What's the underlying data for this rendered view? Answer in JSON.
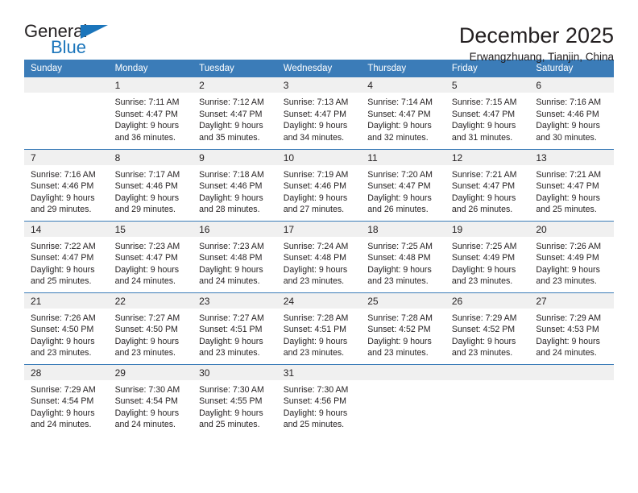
{
  "logo": {
    "word_primary": "General",
    "word_secondary": "Blue",
    "primary_color": "#231f20",
    "accent_color": "#1b75bb"
  },
  "header": {
    "title": "December 2025",
    "subtitle": "Erwangzhuang, Tianjin, China"
  },
  "theme": {
    "header_band": "#3b7cb8",
    "daynum_band": "#f0f0f0",
    "text": "#231f20"
  },
  "weekday_headers": [
    "Sunday",
    "Monday",
    "Tuesday",
    "Wednesday",
    "Thursday",
    "Friday",
    "Saturday"
  ],
  "weeks": [
    [
      {
        "day": "",
        "sunrise": "",
        "sunset": "",
        "daylight_line1": "",
        "daylight_line2": ""
      },
      {
        "day": "1",
        "sunrise": "Sunrise: 7:11 AM",
        "sunset": "Sunset: 4:47 PM",
        "daylight_line1": "Daylight: 9 hours",
        "daylight_line2": "and 36 minutes."
      },
      {
        "day": "2",
        "sunrise": "Sunrise: 7:12 AM",
        "sunset": "Sunset: 4:47 PM",
        "daylight_line1": "Daylight: 9 hours",
        "daylight_line2": "and 35 minutes."
      },
      {
        "day": "3",
        "sunrise": "Sunrise: 7:13 AM",
        "sunset": "Sunset: 4:47 PM",
        "daylight_line1": "Daylight: 9 hours",
        "daylight_line2": "and 34 minutes."
      },
      {
        "day": "4",
        "sunrise": "Sunrise: 7:14 AM",
        "sunset": "Sunset: 4:47 PM",
        "daylight_line1": "Daylight: 9 hours",
        "daylight_line2": "and 32 minutes."
      },
      {
        "day": "5",
        "sunrise": "Sunrise: 7:15 AM",
        "sunset": "Sunset: 4:47 PM",
        "daylight_line1": "Daylight: 9 hours",
        "daylight_line2": "and 31 minutes."
      },
      {
        "day": "6",
        "sunrise": "Sunrise: 7:16 AM",
        "sunset": "Sunset: 4:46 PM",
        "daylight_line1": "Daylight: 9 hours",
        "daylight_line2": "and 30 minutes."
      }
    ],
    [
      {
        "day": "7",
        "sunrise": "Sunrise: 7:16 AM",
        "sunset": "Sunset: 4:46 PM",
        "daylight_line1": "Daylight: 9 hours",
        "daylight_line2": "and 29 minutes."
      },
      {
        "day": "8",
        "sunrise": "Sunrise: 7:17 AM",
        "sunset": "Sunset: 4:46 PM",
        "daylight_line1": "Daylight: 9 hours",
        "daylight_line2": "and 29 minutes."
      },
      {
        "day": "9",
        "sunrise": "Sunrise: 7:18 AM",
        "sunset": "Sunset: 4:46 PM",
        "daylight_line1": "Daylight: 9 hours",
        "daylight_line2": "and 28 minutes."
      },
      {
        "day": "10",
        "sunrise": "Sunrise: 7:19 AM",
        "sunset": "Sunset: 4:46 PM",
        "daylight_line1": "Daylight: 9 hours",
        "daylight_line2": "and 27 minutes."
      },
      {
        "day": "11",
        "sunrise": "Sunrise: 7:20 AM",
        "sunset": "Sunset: 4:47 PM",
        "daylight_line1": "Daylight: 9 hours",
        "daylight_line2": "and 26 minutes."
      },
      {
        "day": "12",
        "sunrise": "Sunrise: 7:21 AM",
        "sunset": "Sunset: 4:47 PM",
        "daylight_line1": "Daylight: 9 hours",
        "daylight_line2": "and 26 minutes."
      },
      {
        "day": "13",
        "sunrise": "Sunrise: 7:21 AM",
        "sunset": "Sunset: 4:47 PM",
        "daylight_line1": "Daylight: 9 hours",
        "daylight_line2": "and 25 minutes."
      }
    ],
    [
      {
        "day": "14",
        "sunrise": "Sunrise: 7:22 AM",
        "sunset": "Sunset: 4:47 PM",
        "daylight_line1": "Daylight: 9 hours",
        "daylight_line2": "and 25 minutes."
      },
      {
        "day": "15",
        "sunrise": "Sunrise: 7:23 AM",
        "sunset": "Sunset: 4:47 PM",
        "daylight_line1": "Daylight: 9 hours",
        "daylight_line2": "and 24 minutes."
      },
      {
        "day": "16",
        "sunrise": "Sunrise: 7:23 AM",
        "sunset": "Sunset: 4:48 PM",
        "daylight_line1": "Daylight: 9 hours",
        "daylight_line2": "and 24 minutes."
      },
      {
        "day": "17",
        "sunrise": "Sunrise: 7:24 AM",
        "sunset": "Sunset: 4:48 PM",
        "daylight_line1": "Daylight: 9 hours",
        "daylight_line2": "and 23 minutes."
      },
      {
        "day": "18",
        "sunrise": "Sunrise: 7:25 AM",
        "sunset": "Sunset: 4:48 PM",
        "daylight_line1": "Daylight: 9 hours",
        "daylight_line2": "and 23 minutes."
      },
      {
        "day": "19",
        "sunrise": "Sunrise: 7:25 AM",
        "sunset": "Sunset: 4:49 PM",
        "daylight_line1": "Daylight: 9 hours",
        "daylight_line2": "and 23 minutes."
      },
      {
        "day": "20",
        "sunrise": "Sunrise: 7:26 AM",
        "sunset": "Sunset: 4:49 PM",
        "daylight_line1": "Daylight: 9 hours",
        "daylight_line2": "and 23 minutes."
      }
    ],
    [
      {
        "day": "21",
        "sunrise": "Sunrise: 7:26 AM",
        "sunset": "Sunset: 4:50 PM",
        "daylight_line1": "Daylight: 9 hours",
        "daylight_line2": "and 23 minutes."
      },
      {
        "day": "22",
        "sunrise": "Sunrise: 7:27 AM",
        "sunset": "Sunset: 4:50 PM",
        "daylight_line1": "Daylight: 9 hours",
        "daylight_line2": "and 23 minutes."
      },
      {
        "day": "23",
        "sunrise": "Sunrise: 7:27 AM",
        "sunset": "Sunset: 4:51 PM",
        "daylight_line1": "Daylight: 9 hours",
        "daylight_line2": "and 23 minutes."
      },
      {
        "day": "24",
        "sunrise": "Sunrise: 7:28 AM",
        "sunset": "Sunset: 4:51 PM",
        "daylight_line1": "Daylight: 9 hours",
        "daylight_line2": "and 23 minutes."
      },
      {
        "day": "25",
        "sunrise": "Sunrise: 7:28 AM",
        "sunset": "Sunset: 4:52 PM",
        "daylight_line1": "Daylight: 9 hours",
        "daylight_line2": "and 23 minutes."
      },
      {
        "day": "26",
        "sunrise": "Sunrise: 7:29 AM",
        "sunset": "Sunset: 4:52 PM",
        "daylight_line1": "Daylight: 9 hours",
        "daylight_line2": "and 23 minutes."
      },
      {
        "day": "27",
        "sunrise": "Sunrise: 7:29 AM",
        "sunset": "Sunset: 4:53 PM",
        "daylight_line1": "Daylight: 9 hours",
        "daylight_line2": "and 24 minutes."
      }
    ],
    [
      {
        "day": "28",
        "sunrise": "Sunrise: 7:29 AM",
        "sunset": "Sunset: 4:54 PM",
        "daylight_line1": "Daylight: 9 hours",
        "daylight_line2": "and 24 minutes."
      },
      {
        "day": "29",
        "sunrise": "Sunrise: 7:30 AM",
        "sunset": "Sunset: 4:54 PM",
        "daylight_line1": "Daylight: 9 hours",
        "daylight_line2": "and 24 minutes."
      },
      {
        "day": "30",
        "sunrise": "Sunrise: 7:30 AM",
        "sunset": "Sunset: 4:55 PM",
        "daylight_line1": "Daylight: 9 hours",
        "daylight_line2": "and 25 minutes."
      },
      {
        "day": "31",
        "sunrise": "Sunrise: 7:30 AM",
        "sunset": "Sunset: 4:56 PM",
        "daylight_line1": "Daylight: 9 hours",
        "daylight_line2": "and 25 minutes."
      },
      {
        "day": "",
        "sunrise": "",
        "sunset": "",
        "daylight_line1": "",
        "daylight_line2": ""
      },
      {
        "day": "",
        "sunrise": "",
        "sunset": "",
        "daylight_line1": "",
        "daylight_line2": ""
      },
      {
        "day": "",
        "sunrise": "",
        "sunset": "",
        "daylight_line1": "",
        "daylight_line2": ""
      }
    ]
  ]
}
